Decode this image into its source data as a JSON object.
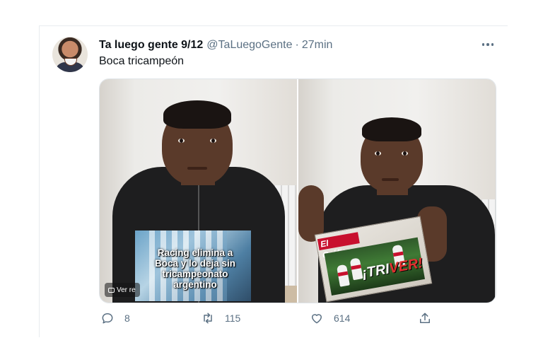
{
  "tweet": {
    "author_name": "Ta luego gente 9/12",
    "handle": "@TaLuegoGente",
    "separator": "·",
    "time": "27min",
    "text": "Boca tricampeón"
  },
  "media": {
    "left": {
      "overlay_caption": "Racing elimina a Boca y lo deja sin tricampeonato argentino",
      "view_pill_label": "Ver re"
    },
    "right": {
      "magazine_logo": "El Gráfico",
      "magazine_headline": "¡TRI",
      "magazine_headline_accent": "VER!"
    }
  },
  "actions": {
    "replies": "8",
    "retweets": "115",
    "likes": "614"
  },
  "icons": [
    "more-icon",
    "reply-icon",
    "retweet-icon",
    "like-icon",
    "share-icon"
  ]
}
